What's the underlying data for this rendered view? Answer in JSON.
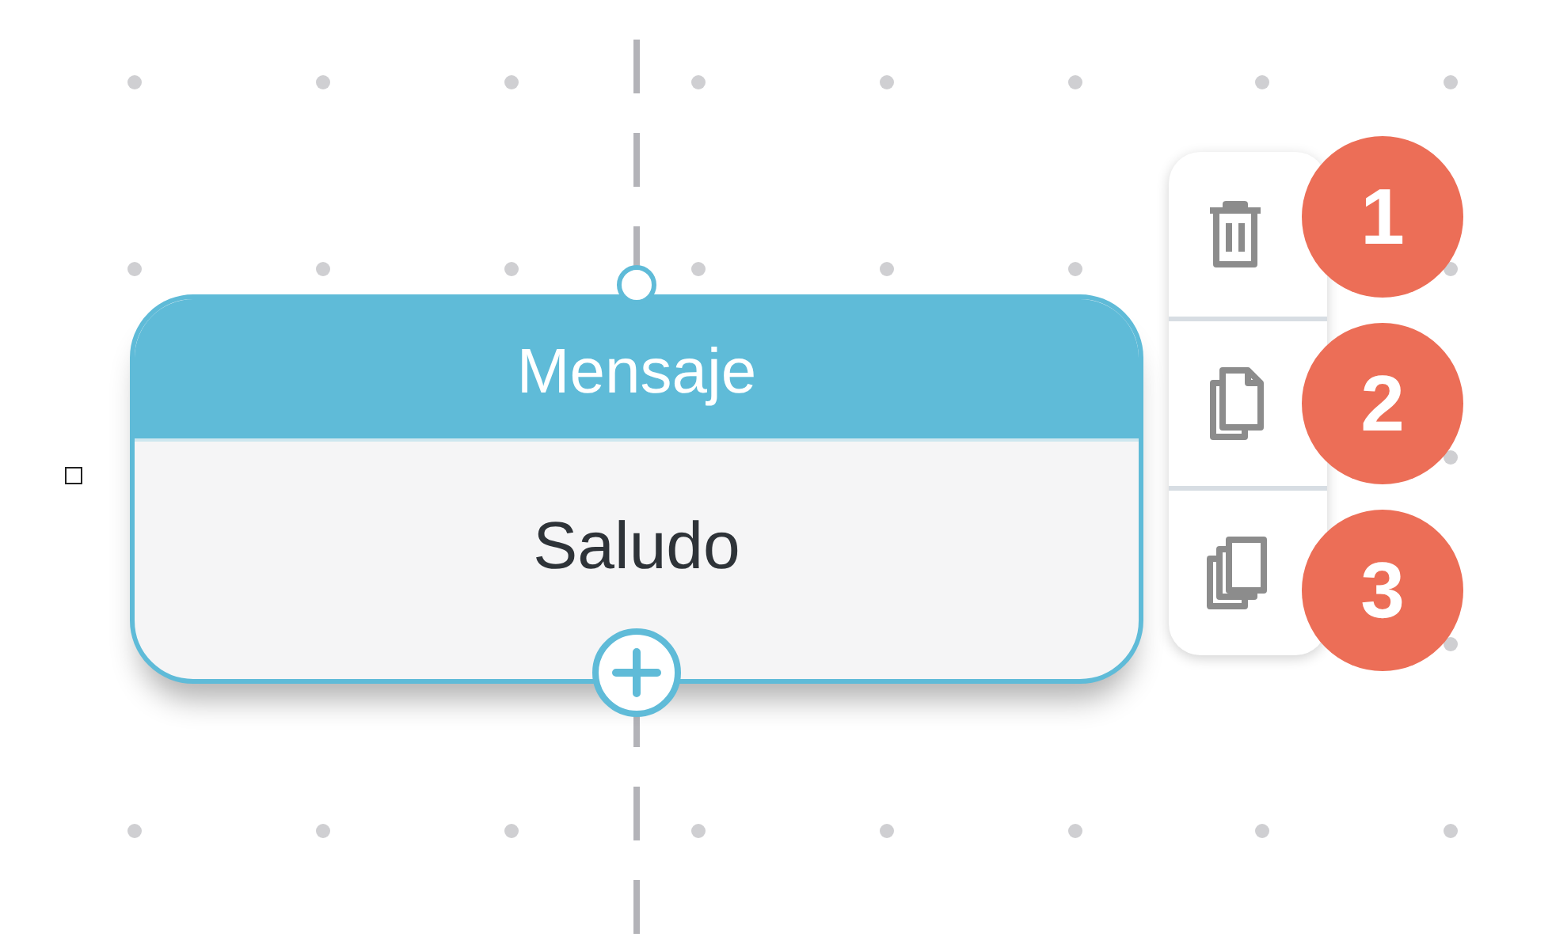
{
  "node": {
    "title": "Mensaje",
    "label": "Saludo"
  },
  "actions": [
    {
      "kind": "delete",
      "badge": "1"
    },
    {
      "kind": "copy",
      "badge": "2"
    },
    {
      "kind": "duplicate",
      "badge": "3"
    }
  ]
}
